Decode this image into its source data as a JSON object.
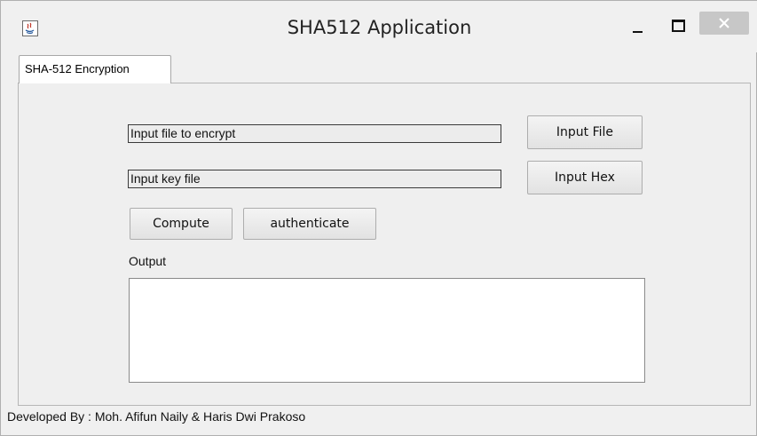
{
  "window": {
    "title": "SHA512 Application"
  },
  "tabs": [
    {
      "label": "SHA-512 Encryption",
      "selected": true
    }
  ],
  "form": {
    "file_field_value": "Input file to encrypt",
    "key_field_value": "Input key file",
    "input_file_button": "Input File",
    "input_hex_button": "Input Hex",
    "compute_button": "Compute",
    "authenticate_button": "authenticate",
    "output_label": "Output",
    "output_value": ""
  },
  "footer": {
    "credit": "Developed By : Moh. Afifun Naily & Haris Dwi Prakoso"
  },
  "icons": {
    "app": "java-app-icon",
    "minimize": "minimize-icon",
    "maximize": "maximize-icon",
    "close": "close-icon"
  },
  "colors": {
    "close_button": "#c7c7c7",
    "background": "#f0f0f0"
  }
}
